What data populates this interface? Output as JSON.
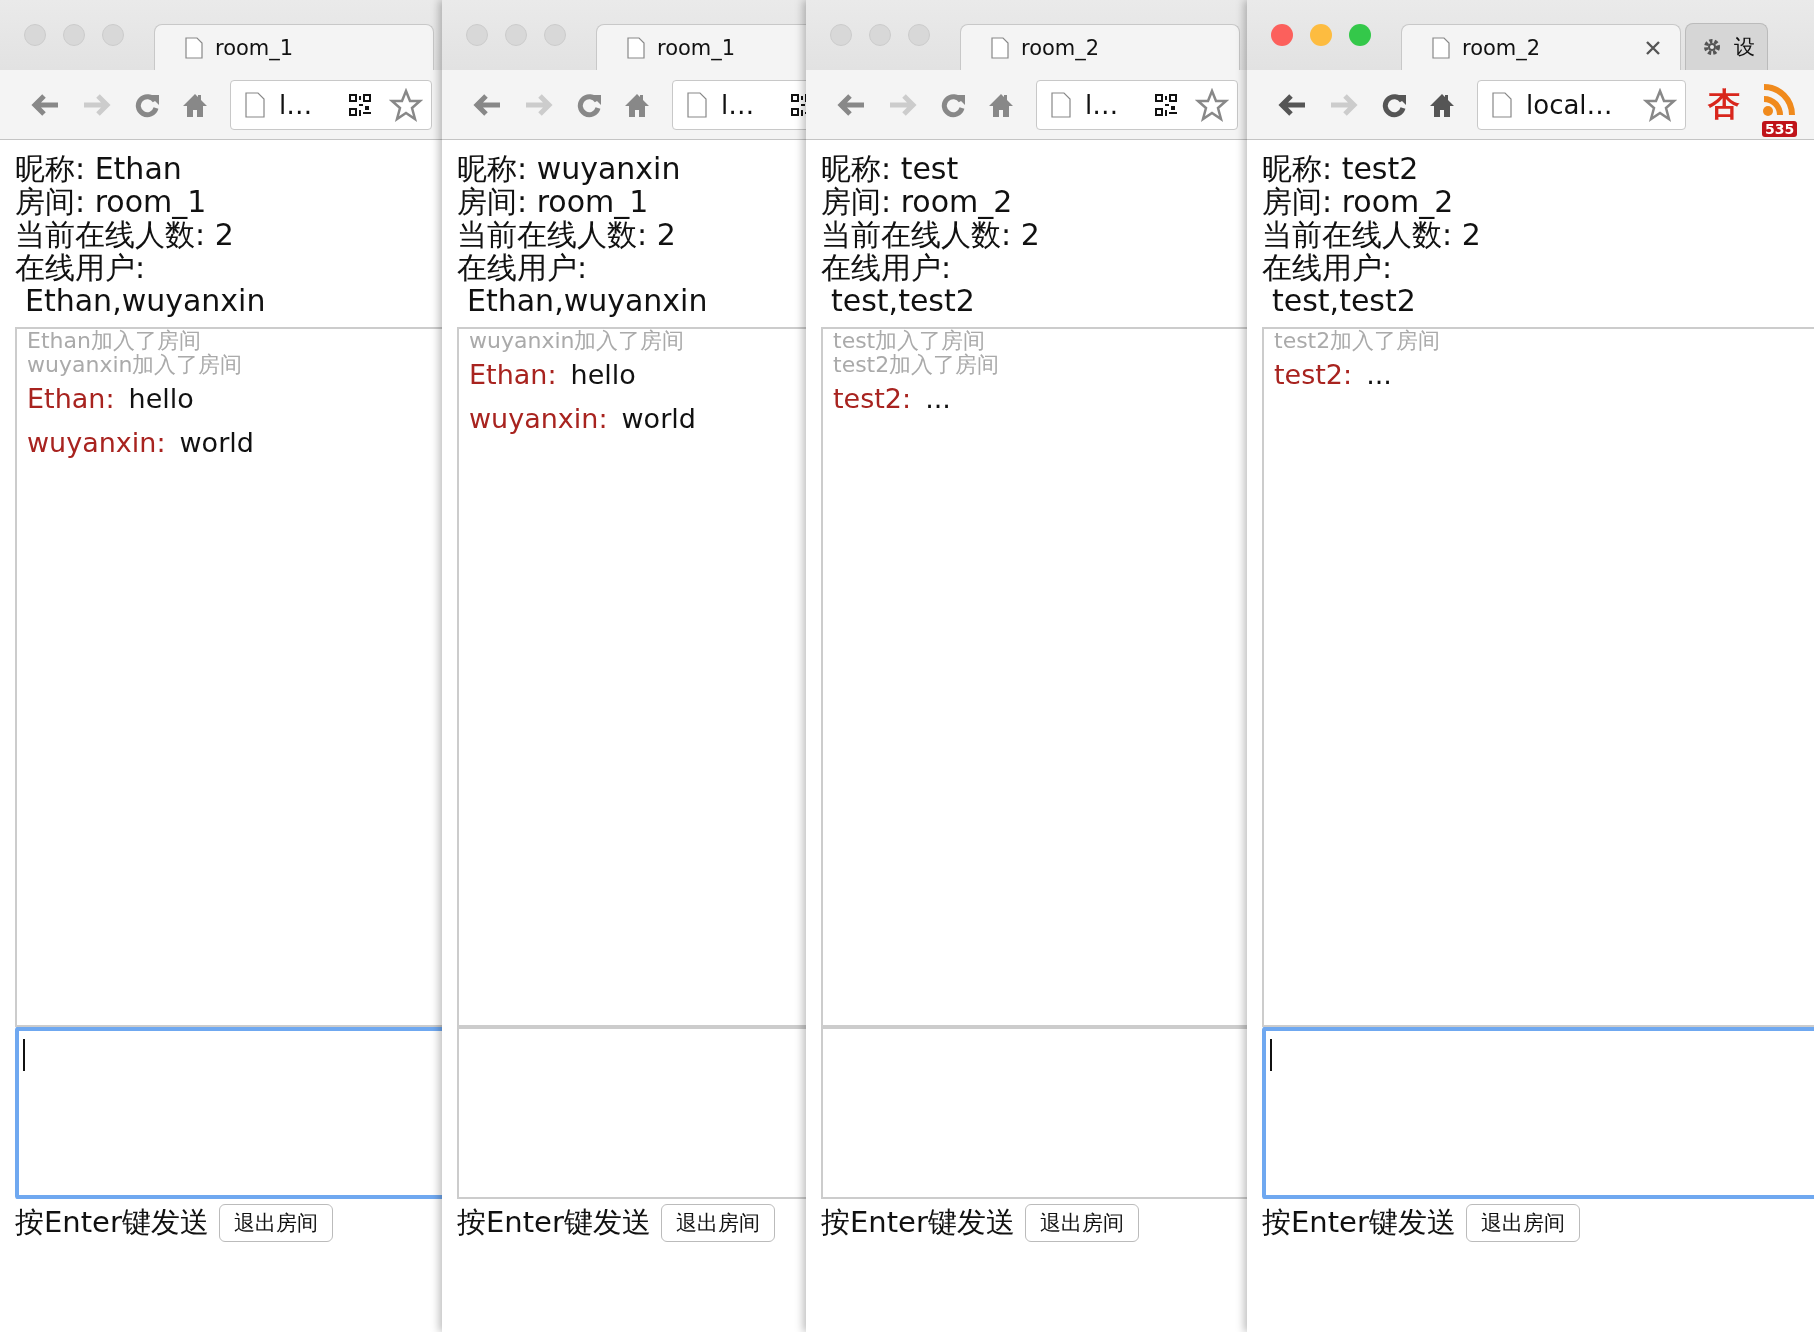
{
  "windows": [
    {
      "active": false,
      "tabs": [
        {
          "title": "room_1",
          "selected": true
        }
      ],
      "address": "l…",
      "qr_code": true,
      "bookmark_star": true,
      "info": [
        "昵称: Ethan",
        "房间: room_1",
        "当前在线人数: 2",
        "在线用户:",
        "Ethan,wuyanxin"
      ],
      "messages": [
        {
          "kind": "system",
          "text": "Ethan加入了房间"
        },
        {
          "kind": "system",
          "text": "wuyanxin加入了房间"
        },
        {
          "kind": "chat",
          "user": "Ethan:",
          "text": "hello"
        },
        {
          "kind": "chat",
          "user": "wuyanxin:",
          "text": "world"
        }
      ],
      "input_focused": true,
      "hint": "按Enter键发送",
      "leave_button": "退出房间"
    },
    {
      "active": false,
      "tabs": [
        {
          "title": "room_1",
          "selected": true
        }
      ],
      "address": "l…",
      "qr_code": true,
      "bookmark_star": false,
      "info": [
        "昵称: wuyanxin",
        "房间: room_1",
        "当前在线人数: 2",
        "在线用户:",
        "Ethan,wuyanxin"
      ],
      "messages": [
        {
          "kind": "system",
          "text": "wuyanxin加入了房间"
        },
        {
          "kind": "chat",
          "user": "Ethan:",
          "text": "hello"
        },
        {
          "kind": "chat",
          "user": "wuyanxin:",
          "text": "world"
        }
      ],
      "input_focused": false,
      "hint": "按Enter键发送",
      "leave_button": "退出房间"
    },
    {
      "active": false,
      "tabs": [
        {
          "title": "room_2",
          "selected": true
        }
      ],
      "address": "l…",
      "qr_code": true,
      "bookmark_star": true,
      "info": [
        "昵称: test",
        "房间: room_2",
        "当前在线人数: 2",
        "在线用户:",
        "test,test2"
      ],
      "messages": [
        {
          "kind": "system",
          "text": "test加入了房间"
        },
        {
          "kind": "system",
          "text": "test2加入了房间"
        },
        {
          "kind": "chat",
          "user": "test2:",
          "text": "..."
        }
      ],
      "input_focused": false,
      "hint": "按Enter键发送",
      "leave_button": "退出房间"
    },
    {
      "active": true,
      "tabs": [
        {
          "title": "room_2",
          "selected": true,
          "closable": true
        },
        {
          "title": "设",
          "selected": false
        }
      ],
      "address": "local…",
      "qr_code": false,
      "bookmark_star": true,
      "extensions": [
        {
          "kind": "glyph",
          "label": "杏"
        },
        {
          "kind": "rss",
          "badge": "535"
        }
      ],
      "info": [
        "昵称: test2",
        "房间: room_2",
        "当前在线人数: 2",
        "在线用户:",
        "test,test2"
      ],
      "messages": [
        {
          "kind": "system",
          "text": "test2加入了房间"
        },
        {
          "kind": "chat",
          "user": "test2:",
          "text": "..."
        }
      ],
      "input_focused": true,
      "hint": "按Enter键发送",
      "leave_button": "退出房间"
    }
  ]
}
